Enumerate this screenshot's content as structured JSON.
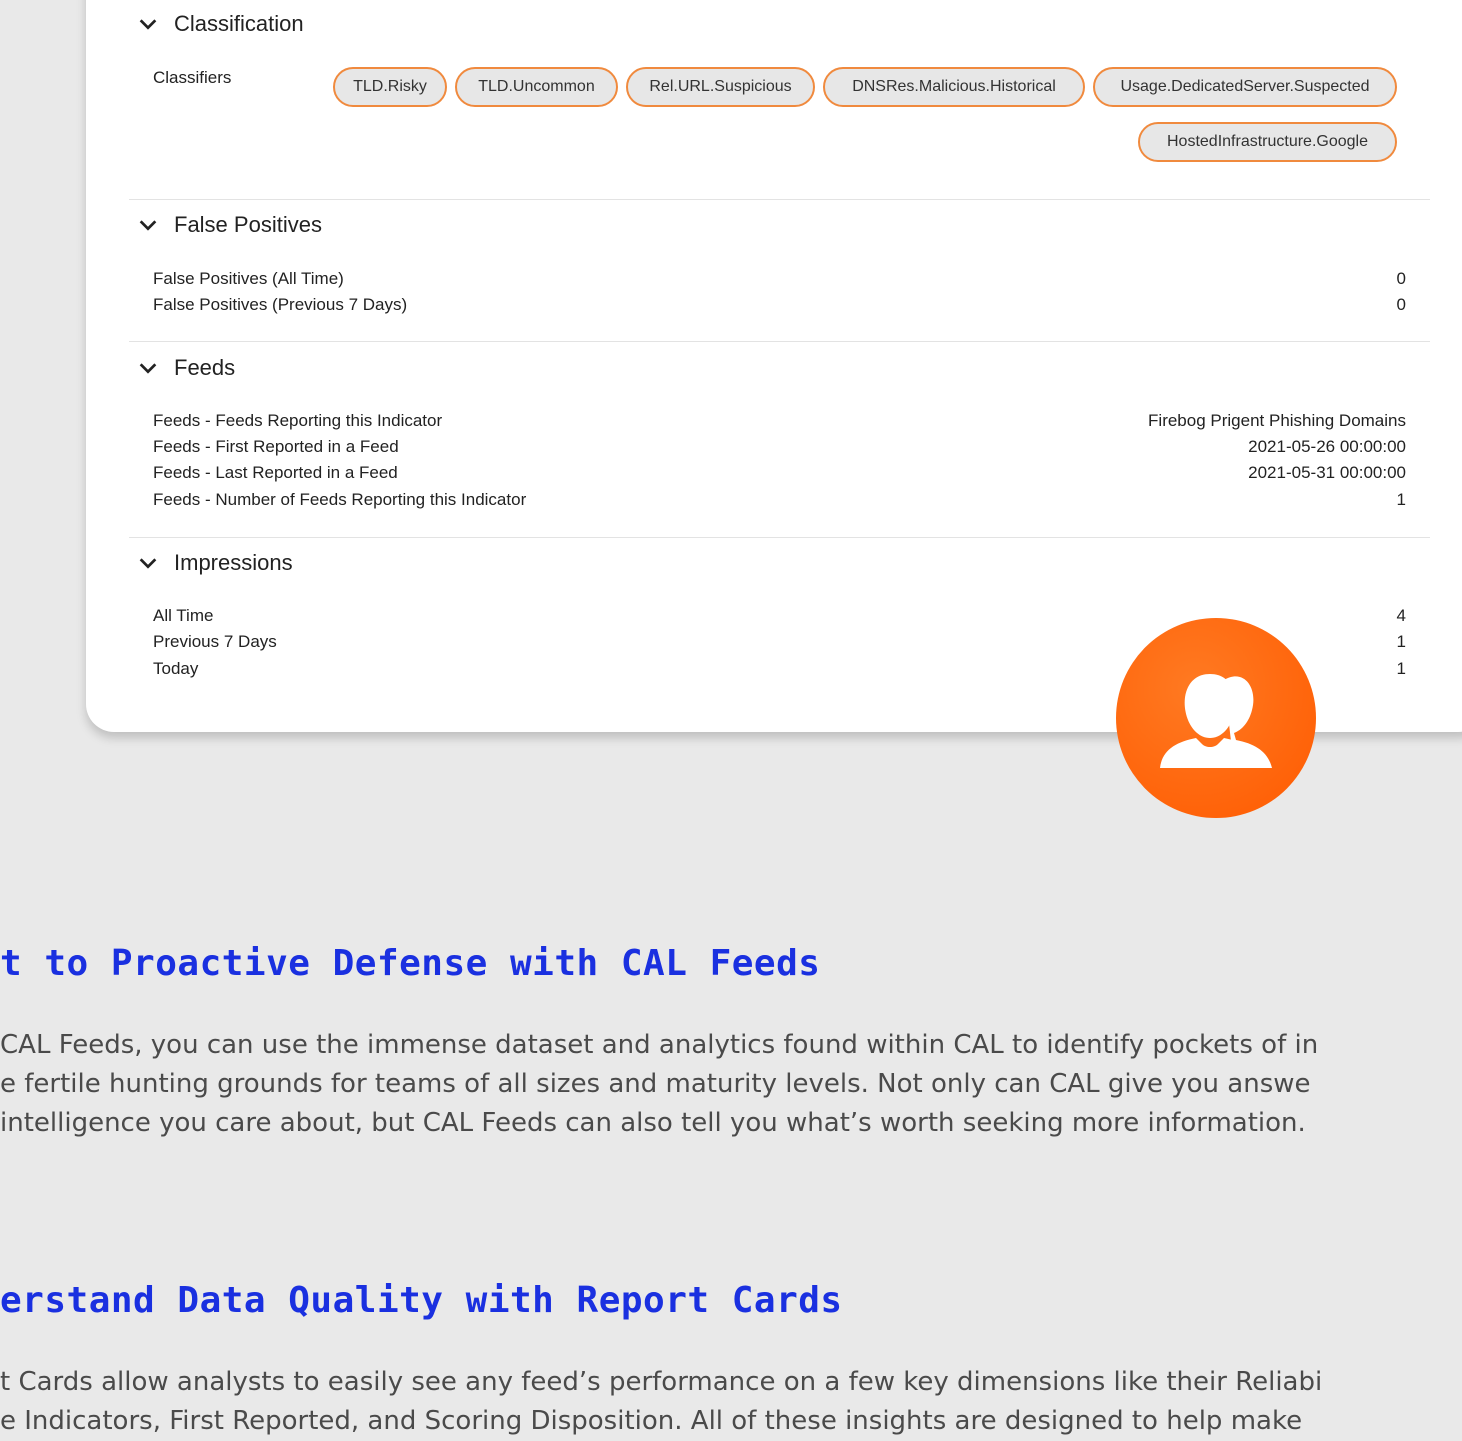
{
  "classification": {
    "title": "Classification",
    "classifiers_label": "Classifiers",
    "pills": [
      "TLD.Risky",
      "TLD.Uncommon",
      "Rel.URL.Suspicious",
      "DNSRes.Malicious.Historical",
      "Usage.DedicatedServer.Suspected",
      "HostedInfrastructure.Google"
    ]
  },
  "false_positives": {
    "title": "False Positives",
    "rows": [
      {
        "label": "False Positives (All Time)",
        "value": "0"
      },
      {
        "label": "False Positives (Previous 7 Days)",
        "value": "0"
      }
    ]
  },
  "feeds": {
    "title": "Feeds",
    "rows": [
      {
        "label": "Feeds - Feeds Reporting this Indicator",
        "value": "Firebog Prigent Phishing Domains"
      },
      {
        "label": "Feeds - First Reported in a Feed",
        "value": "2021-05-26 00:00:00"
      },
      {
        "label": "Feeds - Last Reported in a Feed",
        "value": "2021-05-31 00:00:00"
      },
      {
        "label": "Feeds - Number of Feeds Reporting this Indicator",
        "value": "1"
      }
    ]
  },
  "impressions": {
    "title": "Impressions",
    "rows": [
      {
        "label": "All Time",
        "value": "4"
      },
      {
        "label": "Previous 7 Days",
        "value": "1"
      },
      {
        "label": "Today",
        "value": "1"
      }
    ]
  },
  "article": {
    "heading1": "t to Proactive Defense with CAL Feeds",
    "para1": [
      "CAL Feeds, you can use the immense dataset and analytics found within CAL to identify pockets of in",
      "e fertile hunting grounds for teams of all sizes and maturity levels. Not only can CAL give you answe",
      "intelligence you care about, but CAL Feeds can also tell you what’s worth seeking more information."
    ],
    "heading2": "erstand Data Quality with Report Cards",
    "para2": [
      "t Cards allow analysts to easily see any feed’s performance on a few key dimensions like their Reliabi",
      "e Indicators, First Reported, and Scoring Disposition. All of these insights are designed to help make"
    ]
  },
  "colors": {
    "accent": "#f08a3e",
    "avatar": "#ff6a10",
    "heading": "#1a30e0"
  },
  "icons": {
    "chevron": "chevron-down-icon",
    "avatar": "users-icon"
  }
}
